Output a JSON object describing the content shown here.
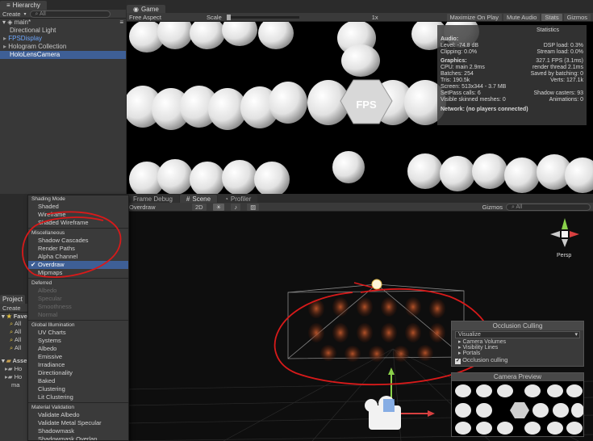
{
  "hierarchy": {
    "tab_label": "Hierarchy",
    "create_label": "Create",
    "search_placeholder": "All",
    "scene_name": "main*",
    "items": [
      {
        "label": "Directional Light",
        "color": "normal"
      },
      {
        "label": "FPSDisplay",
        "color": "blue"
      },
      {
        "label": "Hologram Collection",
        "color": "normal"
      },
      {
        "label": "HoloLensCamera",
        "color": "selected"
      }
    ]
  },
  "game": {
    "tab_label": "Game",
    "aspect_label": "Free Aspect",
    "scale_label": "Scale",
    "scale_value": "1x",
    "maximize_label": "Maximize On Play",
    "mute_label": "Mute Audio",
    "stats_label": "Stats",
    "gizmos_label": "Gizmos",
    "center_text": "FPS"
  },
  "stats": {
    "title": "Statistics",
    "audio_header": "Audio:",
    "audio_rows": [
      {
        "left": "Level: -74.8 dB",
        "right": "DSP load: 0.3%"
      },
      {
        "left": "Clipping: 0.0%",
        "right": "Stream load: 0.0%"
      }
    ],
    "graphics_header": "Graphics:",
    "fps": "327.1 FPS (3.1ms)",
    "graphics_rows": [
      {
        "left": "CPU: main 2.9ms",
        "right": "render thread 2.1ms"
      },
      {
        "left": "Batches: 254",
        "right": "Saved by batching: 0"
      },
      {
        "left": "Tris: 190.5k",
        "right": "Verts: 127.1k"
      },
      {
        "left": "Screen: 513x344 - 3.7 MB",
        "right": ""
      },
      {
        "left": "SetPass calls: 6",
        "right": "Shadow casters: 93"
      },
      {
        "left": "Visible skinned meshes: 0",
        "right": "Animations: 0"
      }
    ],
    "network": "Network: (no players connected)"
  },
  "lower_tabs": {
    "frame_debug": "Frame Debug",
    "scene": "Scene",
    "profiler": "Profiler"
  },
  "scene_toolbar": {
    "mode": "Overdraw",
    "two_d": "2D",
    "gizmos": "Gizmos",
    "search_placeholder": "All"
  },
  "scene_gizmo": {
    "persp": "Persp"
  },
  "project": {
    "tab_label": "Project",
    "create_label": "Create",
    "fav_label": "Fave",
    "all_items": [
      "All",
      "All",
      "All",
      "All"
    ],
    "assets_label": "Asse",
    "asset_items": [
      "Ho",
      "Ho",
      "ma"
    ]
  },
  "menu": {
    "sections": [
      {
        "header": "Shading Mode",
        "items": [
          {
            "label": "Shaded",
            "state": "normal"
          },
          {
            "label": "Wireframe",
            "state": "normal"
          },
          {
            "label": "Shaded Wireframe",
            "state": "normal"
          }
        ]
      },
      {
        "header": "Miscellaneous",
        "items": [
          {
            "label": "Shadow Cascades",
            "state": "normal"
          },
          {
            "label": "Render Paths",
            "state": "normal"
          },
          {
            "label": "Alpha Channel",
            "state": "normal"
          },
          {
            "label": "Overdraw",
            "state": "selected"
          },
          {
            "label": "Mipmaps",
            "state": "normal"
          }
        ]
      },
      {
        "header": "Deferred",
        "items": [
          {
            "label": "Albedo",
            "state": "disabled"
          },
          {
            "label": "Specular",
            "state": "disabled"
          },
          {
            "label": "Smoothness",
            "state": "disabled"
          },
          {
            "label": "Normal",
            "state": "disabled"
          }
        ]
      },
      {
        "header": "Global Illumination",
        "items": [
          {
            "label": "UV Charts",
            "state": "normal"
          },
          {
            "label": "Systems",
            "state": "normal"
          },
          {
            "label": "Albedo",
            "state": "normal"
          },
          {
            "label": "Emissive",
            "state": "normal"
          },
          {
            "label": "Irradiance",
            "state": "normal"
          },
          {
            "label": "Directionality",
            "state": "normal"
          },
          {
            "label": "Baked",
            "state": "normal"
          },
          {
            "label": "Clustering",
            "state": "normal"
          },
          {
            "label": "Lit Clustering",
            "state": "normal"
          }
        ]
      },
      {
        "header": "Material Validation",
        "items": [
          {
            "label": "Validate Albedo",
            "state": "normal"
          },
          {
            "label": "Validate Metal Specular",
            "state": "normal"
          },
          {
            "label": "Shadowmask",
            "state": "normal"
          },
          {
            "label": "Shadowmask Overlap",
            "state": "normal"
          }
        ]
      }
    ],
    "check_glyph": "✔"
  },
  "occlusion": {
    "title": "Occlusion Culling",
    "dropdown": "Visualize",
    "options": [
      "Camera Volumes",
      "Visibility Lines",
      "Portals"
    ],
    "checkbox_label": "Occlusion culling"
  },
  "camera_preview": {
    "title": "Camera Preview"
  },
  "colors": {
    "selection": "#3e5f96",
    "annotation": "#d81a1a",
    "panel": "#383838",
    "background": "#2b2b2b"
  }
}
